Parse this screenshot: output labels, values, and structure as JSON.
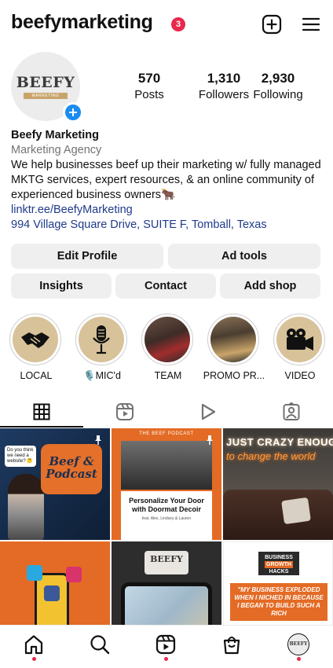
{
  "header": {
    "username": "beefymarketing",
    "notification_count": "3"
  },
  "profile": {
    "avatar_logo": "BEEFY",
    "avatar_logo_sub": "MARKETING",
    "stats": [
      {
        "value": "570",
        "label": "Posts"
      },
      {
        "value": "1,310",
        "label": "Followers"
      },
      {
        "value": "2,930",
        "label": "Following"
      }
    ],
    "name": "Beefy Marketing",
    "category": "Marketing Agency",
    "bio": "We help businesses beef up their marketing w/ fully managed MKTG services, expert resources, & an online community of experienced business owners🐂",
    "link": "linktr.ee/BeefyMarketing",
    "address": "994 Village Square Drive, SUITE F, Tomball, Texas"
  },
  "actions": {
    "edit_profile": "Edit Profile",
    "ad_tools": "Ad tools",
    "insights": "Insights",
    "contact": "Contact",
    "add_shop": "Add shop"
  },
  "highlights": [
    {
      "label": "LOCAL",
      "icon": "handshake-icon"
    },
    {
      "label": "🎙️MIC'd",
      "icon": "microphone-icon"
    },
    {
      "label": "TEAM",
      "icon": "team-photo"
    },
    {
      "label": "PROMO PR...",
      "icon": "promo-photo"
    },
    {
      "label": "VIDEO",
      "icon": "video-camera-icon"
    }
  ],
  "tabs": [
    {
      "name": "grid",
      "icon": "grid-icon",
      "active": true
    },
    {
      "name": "reels",
      "icon": "reels-icon",
      "active": false
    },
    {
      "name": "video",
      "icon": "play-icon",
      "active": false
    },
    {
      "name": "tagged",
      "icon": "tagged-icon",
      "active": false
    }
  ],
  "posts": [
    {
      "bubble": "Do you think we need a website? 🤔",
      "title": "Beef & Podcast",
      "pinned": true
    },
    {
      "header": "THE BEEF PODCAST",
      "title": "Personalize Your Door with Doormat Decoir",
      "subtitle": "feat. Alex, Lindsey & Lauren",
      "pinned": true
    },
    {
      "line1": "JUST CRAZY ENOUGH",
      "line2": "to change the world",
      "pinned": false
    },
    {
      "pinned": false
    },
    {
      "logo": "BEEFY",
      "pinned": false
    },
    {
      "tag_line1": "BUSINESS",
      "tag_line2": "GROWTH",
      "tag_line3": "HACKS",
      "quote": "\"MY BUSINESS EXPLODED WHEN I NICHED IN BECAUSE I BEGAN TO BUILD SUCH A RICH",
      "pinned": false
    }
  ],
  "bottom_nav": [
    {
      "name": "home",
      "icon": "home-icon",
      "dot": true
    },
    {
      "name": "search",
      "icon": "search-icon",
      "dot": false
    },
    {
      "name": "reels",
      "icon": "reels-icon",
      "dot": true
    },
    {
      "name": "shop",
      "icon": "shop-bag-icon",
      "dot": false
    },
    {
      "name": "profile",
      "icon": "profile-avatar",
      "dot": true,
      "avatar_text": "BEEFY"
    }
  ],
  "colors": {
    "notification": "#e8284c",
    "add_button": "#1a8cf0",
    "link": "#1e3a8a",
    "brand_orange": "#e46b25",
    "highlight_tan": "#d8c29a"
  }
}
